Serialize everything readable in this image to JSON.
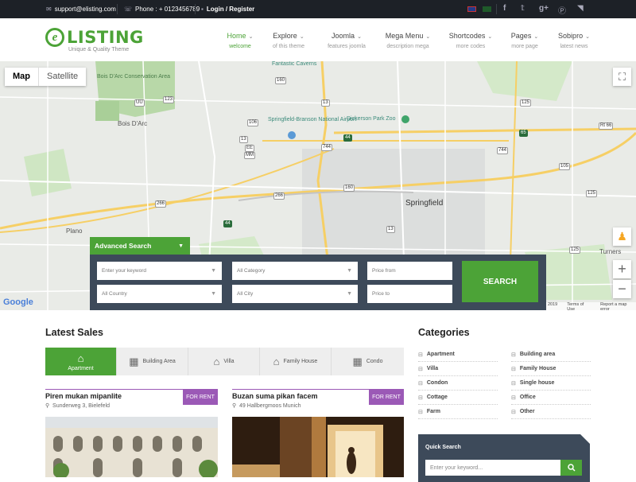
{
  "topbar": {
    "email": "support@elisting.com",
    "phone": "Phone : + 0123456789",
    "login": "Login / Register",
    "social": [
      "facebook-icon",
      "twitter-icon",
      "google-plus-icon",
      "pinterest-icon",
      "rss-icon"
    ]
  },
  "brand": {
    "name": "LISTING",
    "mark": "e",
    "tagline": "Unique & Quality Theme",
    "color": "#4ca337"
  },
  "nav": [
    {
      "label": "Home",
      "sub": "welcome",
      "active": true
    },
    {
      "label": "Explore",
      "sub": "of this theme"
    },
    {
      "label": "Joomla",
      "sub": "features joomla"
    },
    {
      "label": "Mega Menu",
      "sub": "description mega"
    },
    {
      "label": "Shortcodes",
      "sub": "more codes"
    },
    {
      "label": "Pages",
      "sub": "more page"
    },
    {
      "label": "Sobipro",
      "sub": "latest news"
    }
  ],
  "map": {
    "toggle": {
      "map": "Map",
      "satellite": "Satellite"
    },
    "labels": {
      "bois_darc_area": "Bois D'Arc Conservation Area",
      "bois_darc": "Bois D'Arc",
      "airport": "Springfield-Branson National Airport",
      "zoo": "Dickerson Park Zoo",
      "springfield": "Springfield",
      "plano": "Plano",
      "turners": "Turners",
      "fantastic": "Fantastic Caverns"
    },
    "footer": {
      "year": "2019",
      "terms": "Terms of Use",
      "report": "Report a map error",
      "google": "Google"
    }
  },
  "advanced_search": {
    "tab": "Advanced Search",
    "keyword_placeholder": "Enter your keyword",
    "category": "All Category",
    "price_from": "Price from",
    "country": "All Country",
    "city": "All City",
    "price_to": "Price to",
    "button": "SEARCH"
  },
  "latest_sales": {
    "title": "Latest Sales",
    "tabs": [
      {
        "label": "Apartment",
        "icon": "apartment-icon",
        "active": true
      },
      {
        "label": "Building Area",
        "icon": "building-icon"
      },
      {
        "label": "Villa",
        "icon": "villa-icon"
      },
      {
        "label": "Family House",
        "icon": "house-icon"
      },
      {
        "label": "Condo",
        "icon": "condo-icon"
      }
    ],
    "cards": [
      {
        "title": "Piren mukan mipanlite",
        "address": "Sunderweg 3, Bielefeld",
        "badge": "FOR RENT"
      },
      {
        "title": "Buzan suma pikan facem",
        "address": "49 Hallbergmoos Munich",
        "badge": "FOR RENT"
      }
    ]
  },
  "categories": {
    "title": "Categories",
    "left": [
      "Apartment",
      "Villa",
      "Condon",
      "Cottage",
      "Farm"
    ],
    "right": [
      "Building area",
      "Family House",
      "Single house",
      "Office",
      "Other"
    ]
  },
  "quick_search": {
    "title": "Quick Search",
    "placeholder": "Enter your keyword..."
  }
}
